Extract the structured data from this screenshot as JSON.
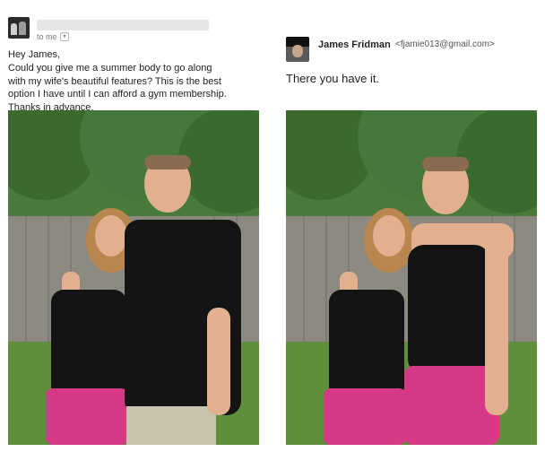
{
  "left_email": {
    "to_label": "to me",
    "toggle_glyph": "▾",
    "greeting": "Hey James,",
    "body_lines": [
      "Could you give me a summer body to go along",
      "with my wife's beautiful features? This is the best",
      "option I have until I can afford a gym membership.",
      "Thanks in advance."
    ]
  },
  "right_email": {
    "sender_name": "James Fridman",
    "sender_email": "<fjamie013@gmail.com>",
    "reply": "There you have it."
  },
  "colors": {
    "foliage": "#3f6b2f",
    "fence": "#8c8a80",
    "grass": "#5f8f3a",
    "black_top": "#141414",
    "pink_shorts": "#d63a86",
    "skin": "#e2b08f"
  }
}
